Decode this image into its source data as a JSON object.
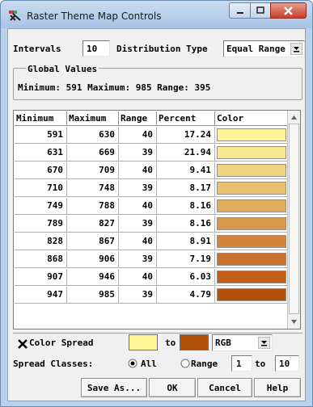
{
  "window": {
    "title": "Raster Theme Map Controls",
    "app_icon": "raster-theme-icon"
  },
  "controls": {
    "intervals_label": "Intervals",
    "intervals_value": "10",
    "distribution_label": "Distribution Type",
    "distribution_value": "Equal Range"
  },
  "global_values": {
    "legend": "Global Values",
    "text": "Minimum: 591  Maximum: 985  Range: 395"
  },
  "table": {
    "columns": [
      "Minimum",
      "Maximum",
      "Range",
      "Percent",
      "Color"
    ],
    "rows": [
      {
        "min": "591",
        "max": "630",
        "range": "40",
        "percent": "17.24",
        "color": "#fff598"
      },
      {
        "min": "631",
        "max": "669",
        "range": "39",
        "percent": "21.94",
        "color": "#f9e690"
      },
      {
        "min": "670",
        "max": "709",
        "range": "40",
        "percent": "9.41",
        "color": "#f0d482"
      },
      {
        "min": "710",
        "max": "748",
        "range": "39",
        "percent": "8.17",
        "color": "#e8c06e"
      },
      {
        "min": "749",
        "max": "788",
        "range": "40",
        "percent": "8.16",
        "color": "#e1ac5c"
      },
      {
        "min": "789",
        "max": "827",
        "range": "39",
        "percent": "8.16",
        "color": "#d9984a"
      },
      {
        "min": "828",
        "max": "867",
        "range": "40",
        "percent": "8.91",
        "color": "#d1853a"
      },
      {
        "min": "868",
        "max": "906",
        "range": "39",
        "percent": "7.19",
        "color": "#c9712a"
      },
      {
        "min": "907",
        "max": "946",
        "range": "40",
        "percent": "6.03",
        "color": "#c15e1a"
      },
      {
        "min": "947",
        "max": "985",
        "range": "39",
        "percent": "4.79",
        "color": "#b3500a"
      }
    ]
  },
  "color_spread": {
    "checkbox_label": "Color Spread",
    "checked": true,
    "from_color": "#fff598",
    "to_label": "to",
    "to_color": "#b3500a",
    "model_value": "RGB"
  },
  "spread_classes": {
    "label": "Spread Classes:",
    "all_label": "All",
    "range_label": "Range",
    "range_from": "1",
    "to_label": "to",
    "range_to": "10",
    "selected": "All"
  },
  "buttons": {
    "save_as": "Save As...",
    "ok": "OK",
    "cancel": "Cancel",
    "help": "Help"
  },
  "colors": {
    "title_bar": "#b9d1ea",
    "close_button": "#c7402c",
    "dialog_bg": "#f0f0f0"
  }
}
